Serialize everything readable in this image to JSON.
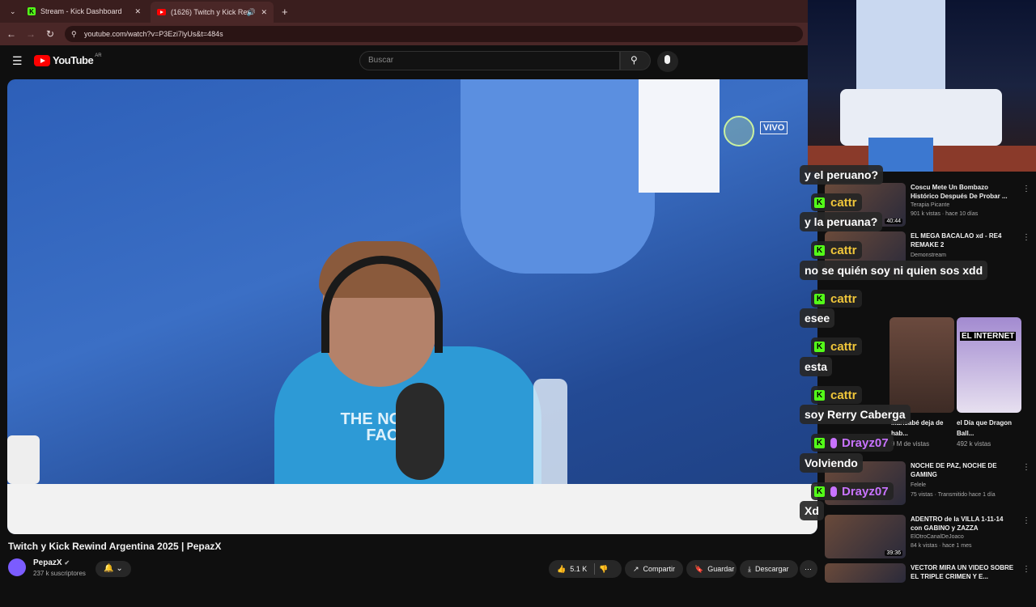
{
  "browser": {
    "tabs": [
      {
        "label": "Stream - Kick Dashboard"
      },
      {
        "label": "(1626) Twitch y Kick Rewind"
      }
    ],
    "new_tab": "+",
    "url": "youtube.com/watch?v=P3Ezi7lyUs&t=484s"
  },
  "youtube": {
    "logo_text": "YouTube",
    "region": "AR",
    "search_placeholder": "Buscar"
  },
  "video": {
    "overlay_badge": "VIVO",
    "shirt_text": "THE NORTH FACE"
  },
  "meta": {
    "title": "Twitch y Kick Rewind Argentina 2025 | PepazX",
    "channel": "PepazX",
    "subscribers": "237 k suscriptores",
    "likes": "5.1 K",
    "share": "Compartir",
    "save": "Guardar",
    "download": "Descargar"
  },
  "chat": [
    {
      "type": "msg",
      "text": "y el peruano?"
    },
    {
      "type": "user",
      "name": "cattr",
      "badge": "kick"
    },
    {
      "type": "msg",
      "text": "y la peruana?"
    },
    {
      "type": "user",
      "name": "cattr",
      "badge": "kick"
    },
    {
      "type": "msg",
      "text": "no se quién soy ni quien sos xdd"
    },
    {
      "type": "user",
      "name": "cattr",
      "badge": "kick"
    },
    {
      "type": "msg",
      "text": "esee"
    },
    {
      "type": "user",
      "name": "cattr",
      "badge": "kick"
    },
    {
      "type": "msg",
      "text": "esta"
    },
    {
      "type": "user",
      "name": "cattr",
      "badge": "kick"
    },
    {
      "type": "msg",
      "text": "soy Rerry Caberga"
    },
    {
      "type": "user",
      "name": "Drayz07",
      "badge": "kick-mic"
    },
    {
      "type": "msg",
      "text": "Volviendo"
    },
    {
      "type": "user",
      "name": "Drayz07",
      "badge": "kick-mic"
    },
    {
      "type": "msg",
      "text": "Xd"
    }
  ],
  "recommendations": [
    {
      "title": "Coscu Mete Un Bombazo Histórico Después De Probar ...",
      "channel": "Terapia Picante",
      "meta": "901 k vistas · hace 10 días",
      "duration": "40:44"
    },
    {
      "title": "EL MEGA BACALAO xd - RE4 REMAKE 2",
      "channel": "Demonstream",
      "meta": "",
      "duration": ""
    },
    {
      "title": "NOCHE DE PAZ, NOCHE DE GAMING",
      "channel": "Felele",
      "meta": "75 vistas · Transmitido hace 1 día",
      "duration": ""
    },
    {
      "title": "ADENTRO de la VILLA 1-11-14 con GABINO y ZAZZA",
      "channel": "ElOtroCanalDeJoaco",
      "meta": "84 k vistas · hace 1 mes",
      "duration": "39:36"
    },
    {
      "title": "VECTOR MIRA UN VIDEO SOBRE EL TRIPLE CRIMEN Y E...",
      "channel": "",
      "meta": "",
      "duration": ""
    }
  ],
  "shorts": [
    {
      "title": "Marisabé deja de hab...",
      "views": "9 M de vistas"
    },
    {
      "title": "el Día que Dragon Ball...",
      "views": "492 k vistas",
      "thumb_text": "EL INTERNET"
    }
  ],
  "colors": {
    "kick_green": "#53fc18",
    "yt_red": "#ff0000",
    "tab_bg": "#3a1e1e"
  }
}
